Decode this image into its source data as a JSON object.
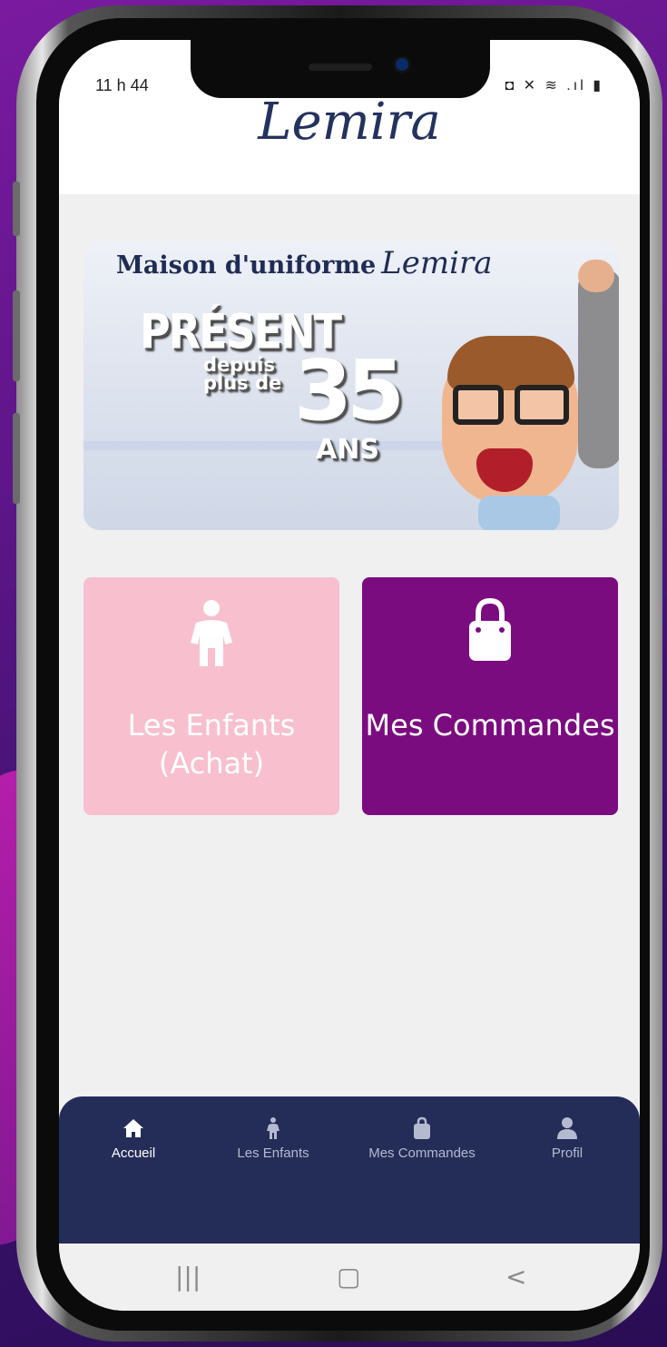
{
  "status_bar": {
    "time": "11 h 44",
    "icons": "◘ ✕ ≋ .ıl ▮"
  },
  "app": {
    "logo_text": "Lemira"
  },
  "banner": {
    "title": "Maison d'uniforme",
    "title_script": "Lemira",
    "promo_present": "PRÉSENT",
    "promo_depuis": "depuis plus de",
    "promo_number": "35",
    "promo_ans": "ANS"
  },
  "tiles": [
    {
      "label": "Les Enfants (Achat)",
      "icon": "child-icon",
      "color": "#f8bfcf"
    },
    {
      "label": "Mes Commandes",
      "icon": "shopping-bag-icon",
      "color": "#7b0c80"
    }
  ],
  "bottom_nav": {
    "items": [
      {
        "label": "Accueil",
        "icon": "home-icon",
        "active": true
      },
      {
        "label": "Les Enfants",
        "icon": "child-icon",
        "active": false
      },
      {
        "label": "Mes Commandes",
        "icon": "shopping-bag-icon",
        "active": false
      },
      {
        "label": "Profil",
        "icon": "user-icon",
        "active": false
      }
    ],
    "color": "#242d58"
  },
  "system_nav": {
    "recents": "|||",
    "home": "▢",
    "back": "<"
  }
}
